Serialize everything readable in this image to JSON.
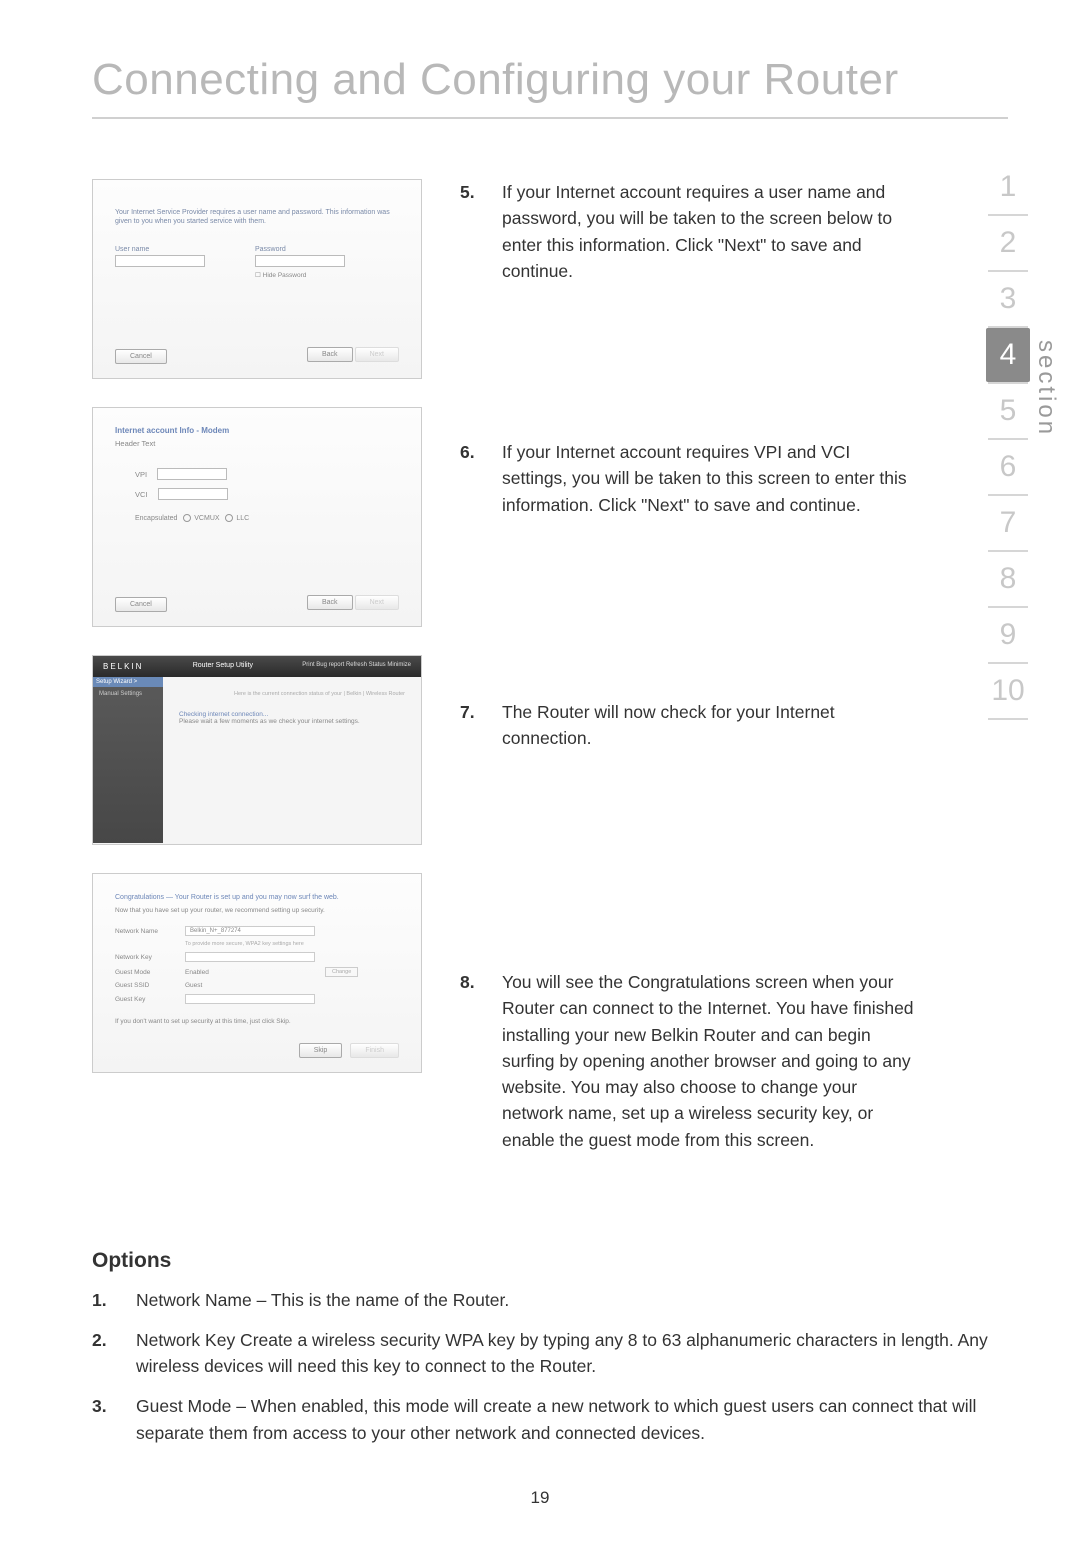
{
  "page_title": "Connecting and Configuring your Router",
  "page_number": "19",
  "section_label": "section",
  "nav_numbers": [
    "1",
    "2",
    "3",
    "4",
    "5",
    "6",
    "7",
    "8",
    "9",
    "10"
  ],
  "nav_active": "4",
  "steps": {
    "s5": {
      "n": "5.",
      "text": "If your Internet account requires a user name and password, you will be taken to the screen below to enter this information. Click \"Next\" to save and continue."
    },
    "s6": {
      "n": "6.",
      "text": "If your Internet account requires VPI and VCI settings, you will be taken to this screen to enter this information. Click \"Next\" to save and continue."
    },
    "s7": {
      "n": "7.",
      "text": "The Router will now check for your Internet connection."
    },
    "s8": {
      "n": "8.",
      "text": "You will see the Congratulations screen when your Router can connect to the Internet. You have finished installing your new Belkin Router and can begin surfing by opening another browser and going to any website. You may also choose to change your network name, set up a wireless security key, or enable the guest mode from this screen."
    }
  },
  "options": {
    "heading": "Options",
    "o1": {
      "n": "1.",
      "text": "Network Name – This is the name of the Router."
    },
    "o2": {
      "n": "2.",
      "text": "Network Key  Create a wireless security WPA key by typing any 8 to 63 alphanumeric characters in length. Any wireless devices will need this key to connect to the Router."
    },
    "o3": {
      "n": "3.",
      "text": "Guest Mode – When enabled, this mode will create a new network to which guest users can connect that will separate them from access to your other network and connected devices."
    }
  },
  "shot1": {
    "desc": "Your Internet Service Provider requires a user name and password. This information was given to you when you started service with them.",
    "user_label": "User name",
    "pass_label": "Password",
    "chk": "Hide Password",
    "cancel": "Cancel",
    "back": "Back",
    "next": "Next"
  },
  "shot2": {
    "header": "Internet account Info - Modem",
    "sub": "Header Text",
    "vpi": "VPI",
    "vci": "VCI",
    "enc_label": "Encapsulated",
    "enc_a": "VCMUX",
    "enc_b": "LLC",
    "cancel": "Cancel",
    "back": "Back",
    "next": "Next"
  },
  "shot3": {
    "brand": "BELKIN",
    "utility": "Router Setup Utility",
    "tools": "Print   Bug report   Refresh Status   Minimize",
    "side1": "Setup Wizard  >",
    "side2": "Manual Settings",
    "crumbs": "Here is the current connection status of your | Belkin | Wireless Router",
    "line1": "Checking internet connection...",
    "line2": "Please wait a few moments as we check your internet settings."
  },
  "shot4": {
    "l1": "Congratulations — Your Router is set up and you may now surf the web.",
    "l2": "Now that you have set up your router, we recommend setting up security.",
    "r1l": "Network Name",
    "r1v": "Belkin_N+_877274",
    "r2l": "",
    "r2v": "To provide more secure, WPA2 key settings here",
    "r3l": "Network Key",
    "r3v": "",
    "r4l": "Guest Mode",
    "r4v": "Enabled",
    "chip": "Change",
    "r5l": "Guest SSID",
    "r5v": "Guest",
    "r6l": "Guest Key",
    "r6v": "",
    "note": "If you don't want to set up security at this time, just click Skip.",
    "skip": "Skip",
    "finish": "Finish"
  }
}
